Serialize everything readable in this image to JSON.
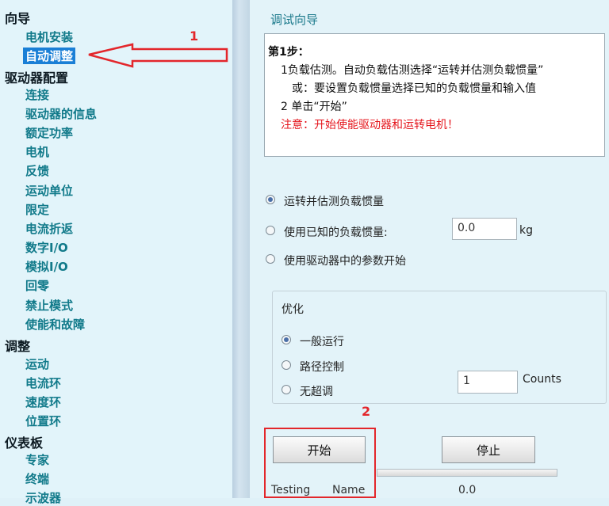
{
  "nav": {
    "groups": [
      {
        "title": "向导",
        "items": [
          "电机安装",
          "自动调整"
        ]
      },
      {
        "title": "驱动器配置",
        "items": [
          "连接",
          "驱动器的信息",
          "额定功率",
          "电机",
          "反馈",
          "运动单位",
          "限定",
          "电流折返",
          "数字I/O",
          "模拟I/O",
          "回零",
          "禁止模式",
          "使能和故障"
        ]
      },
      {
        "title": "调整",
        "items": [
          "运动",
          "电流环",
          "速度环",
          "位置环"
        ]
      },
      {
        "title": "仪表板",
        "items": [
          "专家",
          "终端",
          "示波器"
        ]
      }
    ],
    "selected_item": "自动调整"
  },
  "panel": {
    "title": "调试向导",
    "instructions": {
      "step": "第1步：",
      "line1": "1负载估测。自动负载估测选择“运转并估测负载惯量”",
      "line2": "或：要设置负载惯量选择已知的负载惯量和输入值",
      "line3": "2 单击“开始”",
      "warning": "注意：开始使能驱动器和运转电机！"
    },
    "load_options": {
      "opt1": "运转并估测负载惯量",
      "opt2": "使用已知的负载惯量:",
      "opt2_value": "0.0",
      "opt2_unit": "kg",
      "opt3": "使用驱动器中的参数开始",
      "selected": "运转并估测负载惯量"
    },
    "optimize": {
      "title": "优化",
      "opt1": "一般运行",
      "opt2": "路径控制",
      "opt3": "无超调",
      "selected": "一般运行",
      "counts_value": "1",
      "counts_unit": "Counts"
    },
    "buttons": {
      "start": "开始",
      "stop": "停止"
    },
    "status": {
      "testing": "Testing",
      "name": "Name",
      "value": "0.0"
    }
  },
  "annotations": {
    "arrow_label": "1",
    "box_label": "2",
    "color": "#e3262b"
  }
}
